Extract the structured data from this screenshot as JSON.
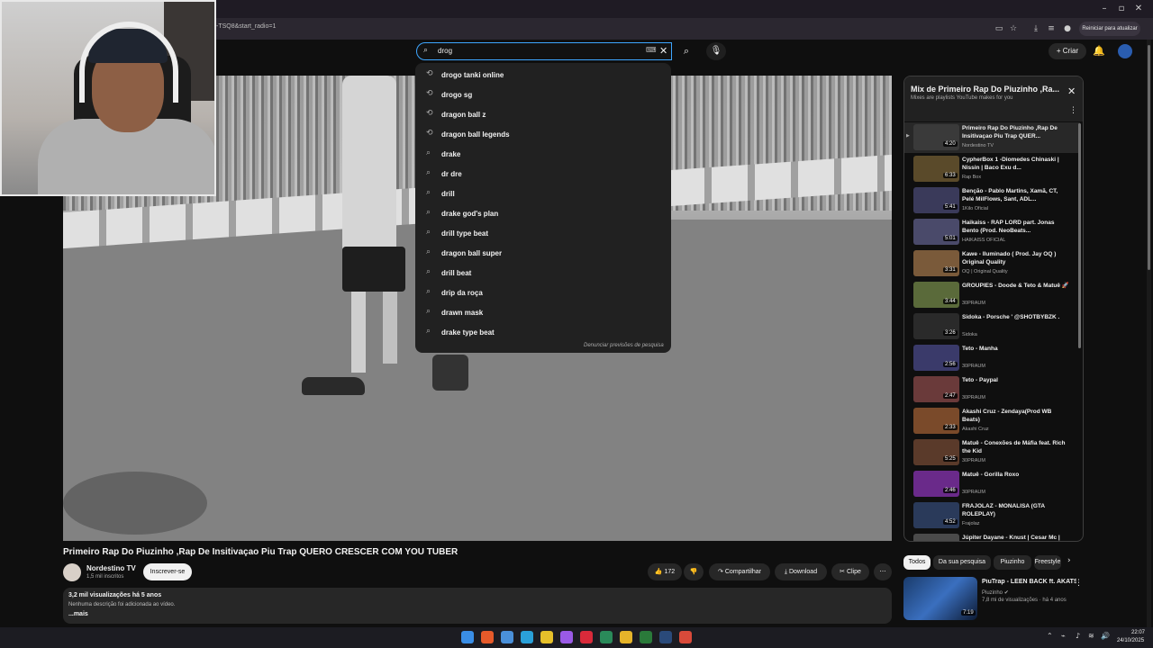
{
  "browser": {
    "url_fragment": "-TSQ8&start_radio=1",
    "update_label": "Reiniciar para atualizar",
    "win_controls": [
      "–",
      "▫",
      "✕"
    ]
  },
  "header": {
    "search_value": "drog",
    "create_label": "Criar"
  },
  "suggestions": {
    "items": [
      {
        "text": "drogo tanki online",
        "type": "history"
      },
      {
        "text": "drogo sg",
        "type": "history"
      },
      {
        "text": "dragon ball z",
        "type": "history"
      },
      {
        "text": "dragon ball legends",
        "type": "history"
      },
      {
        "text": "drake",
        "type": "search"
      },
      {
        "text": "dr dre",
        "type": "search"
      },
      {
        "text": "drill",
        "type": "search"
      },
      {
        "text": "drake god's plan",
        "type": "search"
      },
      {
        "text": "drill type beat",
        "type": "search"
      },
      {
        "text": "dragon ball super",
        "type": "search"
      },
      {
        "text": "drill beat",
        "type": "search"
      },
      {
        "text": "drip da roça",
        "type": "search"
      },
      {
        "text": "drawn mask",
        "type": "search"
      },
      {
        "text": "drake type beat",
        "type": "search"
      }
    ],
    "report_label": "Denunciar previsões de pesquisa"
  },
  "video": {
    "title": "Primeiro Rap Do Piuzinho ,Rap De Insitivaçao Piu Trap QUERO CRESCER COM YOU TUBER",
    "channel": "Nordestino TV",
    "subscribers": "1,5 mil inscritos",
    "subscribe_label": "Inscrever-se",
    "likes": "172",
    "share_label": "Compartilhar",
    "download_label": "Download",
    "clip_label": "Clipe",
    "views_line": "3,2 mil visualizações  há 5 anos",
    "description": "Nenhuma descrição foi adicionada ao vídeo.",
    "more_label": "...mais"
  },
  "playlist": {
    "title": "Mix de Primeiro Rap Do Piuzinho ,Ra...",
    "subtitle": "Mixes are playlists YouTube makes for you",
    "items": [
      {
        "title": "Primeiro Rap Do Piuzinho ,Rap De Insitivaçao Piu Trap QUER...",
        "channel": "Nordestino TV",
        "duration": "4:20",
        "color": "#3a3a3a"
      },
      {
        "title": "CypherBox 1 -Diomedes Chinaski | Nissin | Baco Exu d...",
        "channel": "Rap Box",
        "duration": "6:33",
        "color": "#5a4a2a"
      },
      {
        "title": "Benção - Pablo Martins, Xamã, CT, Pelé MilFlows, Sant, ADL...",
        "channel": "1Kilo Oficial",
        "duration": "5:41",
        "color": "#3a3a5a"
      },
      {
        "title": "Haikaiss - RAP LORD part. Jonas Bento (Prod. NeoBeats...",
        "channel": "HAIKAISS OFICIAL",
        "duration": "5:01",
        "color": "#4a4a6a"
      },
      {
        "title": "Kawe - Iluminado ( Prod. Jay OQ ) Original Quality",
        "channel": "OQ | Original Quality",
        "duration": "3:31",
        "color": "#7a5a3a"
      },
      {
        "title": "GROUPIES - Doode & Teto & Matuê 🚀",
        "channel": "30PRAUM",
        "duration": "3:44",
        "color": "#5a6a3a"
      },
      {
        "title": "Sidoka - Porsche ' @SHOTBYBZK .",
        "channel": "Sidoka",
        "duration": "3:26",
        "color": "#2a2a2a"
      },
      {
        "title": "Teto - Manha",
        "channel": "30PRAUM",
        "duration": "2:56",
        "color": "#3a3a6a"
      },
      {
        "title": "Teto - Paypal",
        "channel": "30PRAUM",
        "duration": "2:47",
        "color": "#6a3a3a"
      },
      {
        "title": "Akashi Cruz - Zendaya(Prod WB Beats)",
        "channel": "Akashi Cruz",
        "duration": "2:33",
        "color": "#7a4a2a"
      },
      {
        "title": "Matuê - Conexões de Máfia feat. Rich the Kid",
        "channel": "30PRAUM",
        "duration": "5:25",
        "color": "#5a3a2a"
      },
      {
        "title": "Matuê - Gorilla Roxo",
        "channel": "30PRAUM",
        "duration": "2:46",
        "color": "#6a2a8a"
      },
      {
        "title": "FRAJOLAZ - MONALISA (GTA ROLEPLAY)",
        "channel": "Frajolaz",
        "duration": "4:52",
        "color": "#2a3a5a"
      },
      {
        "title": "Júpiter Dayane - Knust | Cesar Mc | Xamã | Chris (Prod....",
        "channel": "",
        "duration": "",
        "color": "#4a4a4a"
      }
    ]
  },
  "chips": [
    "Todos",
    "Da sua pesquisa",
    "Piuzinho",
    "Freestyle"
  ],
  "recommended": {
    "title": "PiuTrap - LEEN BACK  ft. AKATS",
    "channel": "Piuzinho",
    "meta": "7,8 mi de visualizações · há 4 anos",
    "duration": "7:19"
  },
  "taskbar": {
    "time": "22:07",
    "date": "24/10/2025",
    "apps": [
      {
        "name": "start-icon",
        "color": "#3a8ee6"
      },
      {
        "name": "office-icon",
        "color": "#e65a2a"
      },
      {
        "name": "calendar-icon",
        "color": "#4a90d9"
      },
      {
        "name": "edge-icon",
        "color": "#2aa0d9"
      },
      {
        "name": "chrome-icon",
        "color": "#e6c02a"
      },
      {
        "name": "messenger-icon",
        "color": "#9a5ae6"
      },
      {
        "name": "opera-icon",
        "color": "#d92a3a"
      },
      {
        "name": "app-icon",
        "color": "#2a8a5a"
      },
      {
        "name": "folder-icon",
        "color": "#e6b42a"
      },
      {
        "name": "excel-icon",
        "color": "#2a7a3a"
      },
      {
        "name": "steam-icon",
        "color": "#2a4a7a"
      },
      {
        "name": "chrome-alt-icon",
        "color": "#d94a3a"
      }
    ]
  }
}
